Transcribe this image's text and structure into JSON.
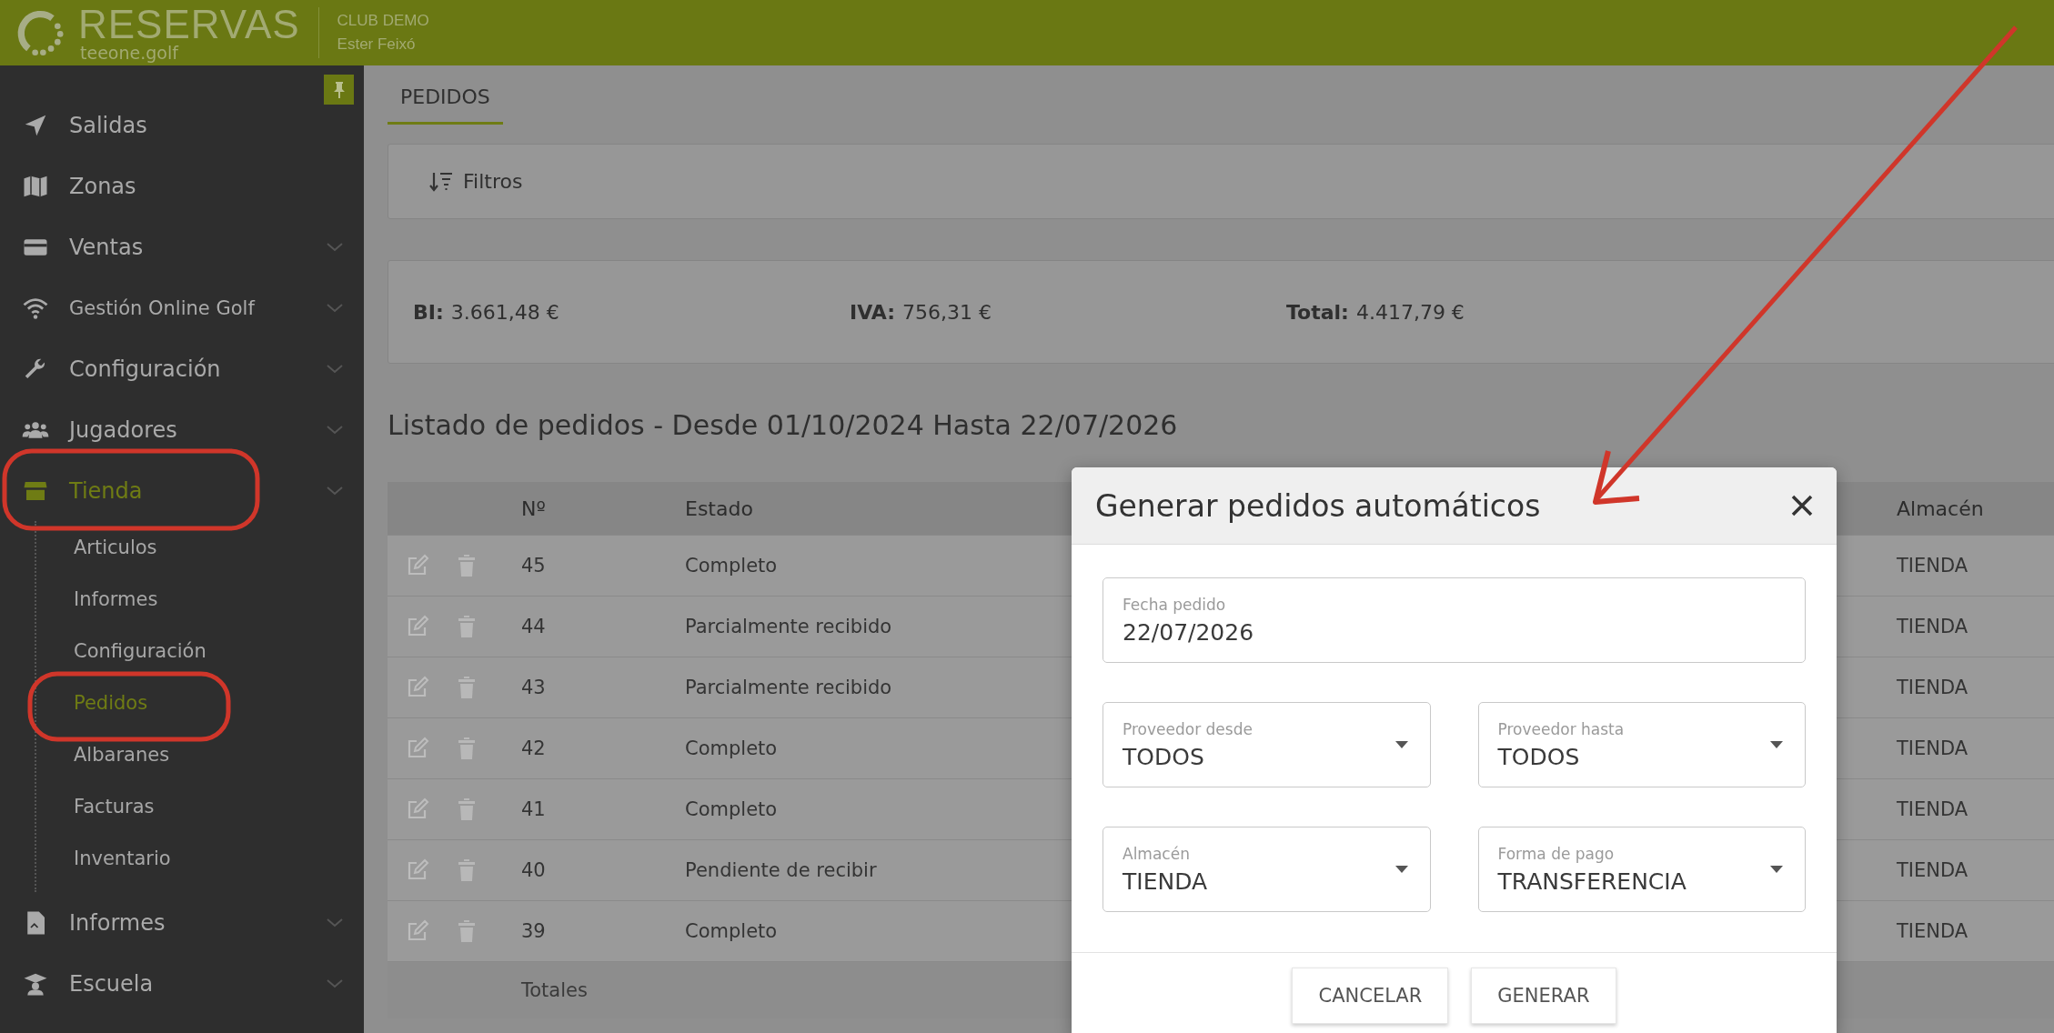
{
  "header": {
    "logo_title": "RESERVAS",
    "logo_subtitle": "teeone.golf",
    "club": "CLUB DEMO",
    "user": "Ester Feixó"
  },
  "sidebar": {
    "items": [
      {
        "label": "Salidas",
        "expandable": false,
        "selected": false
      },
      {
        "label": "Zonas",
        "expandable": false,
        "selected": false
      },
      {
        "label": "Ventas",
        "expandable": true,
        "selected": false
      },
      {
        "label": "Gestión Online Golf",
        "expandable": true,
        "selected": false
      },
      {
        "label": "Configuración",
        "expandable": true,
        "selected": false
      },
      {
        "label": "Jugadores",
        "expandable": true,
        "selected": false
      },
      {
        "label": "Tienda",
        "expandable": true,
        "selected": true,
        "children": [
          {
            "label": "Articulos",
            "selected": false
          },
          {
            "label": "Informes",
            "selected": false
          },
          {
            "label": "Configuración",
            "selected": false
          },
          {
            "label": "Pedidos",
            "selected": true
          },
          {
            "label": "Albaranes",
            "selected": false
          },
          {
            "label": "Facturas",
            "selected": false
          },
          {
            "label": "Inventario",
            "selected": false
          }
        ]
      },
      {
        "label": "Informes",
        "expandable": true,
        "selected": false
      },
      {
        "label": "Escuela",
        "expandable": true,
        "selected": false
      }
    ]
  },
  "tabs": [
    {
      "label": "PEDIDOS",
      "selected": true
    }
  ],
  "filters": {
    "label": "Filtros"
  },
  "totals": [
    {
      "label": "BI:",
      "value": "3.661,48 €"
    },
    {
      "label": "IVA:",
      "value": "756,31 €"
    },
    {
      "label": "Total:",
      "value": "4.417,79 €"
    }
  ],
  "list_title": "Listado de pedidos - Desde 01/10/2024 Hasta 22/07/2026",
  "table": {
    "columns": [
      "Nº",
      "Estado",
      "Almacén"
    ],
    "rows": [
      {
        "number": "45",
        "status": "Completo",
        "warehouse": "TIENDA"
      },
      {
        "number": "44",
        "status": "Parcialmente recibido",
        "warehouse": "TIENDA"
      },
      {
        "number": "43",
        "status": "Parcialmente recibido",
        "warehouse": "TIENDA"
      },
      {
        "number": "42",
        "status": "Completo",
        "warehouse": "TIENDA"
      },
      {
        "number": "41",
        "status": "Completo",
        "warehouse": "TIENDA"
      },
      {
        "number": "40",
        "status": "Pendiente de recibir",
        "warehouse": "TIENDA"
      },
      {
        "number": "39",
        "status": "Completo",
        "warehouse": "TIENDA"
      }
    ],
    "footer": "Totales"
  },
  "modal": {
    "title": "Generar pedidos automáticos",
    "fields": [
      {
        "kind": "text",
        "label": "Fecha pedido",
        "value": "22/07/2026"
      },
      {
        "kind": "select",
        "label": "Proveedor desde",
        "value": "TODOS"
      },
      {
        "kind": "select",
        "label": "Proveedor hasta",
        "value": "TODOS"
      },
      {
        "kind": "select",
        "label": "Almacén",
        "value": "TIENDA"
      },
      {
        "kind": "select",
        "label": "Forma de pago",
        "value": "TRANSFERENCIA"
      }
    ],
    "buttons": [
      "CANCELAR",
      "GENERAR"
    ]
  }
}
